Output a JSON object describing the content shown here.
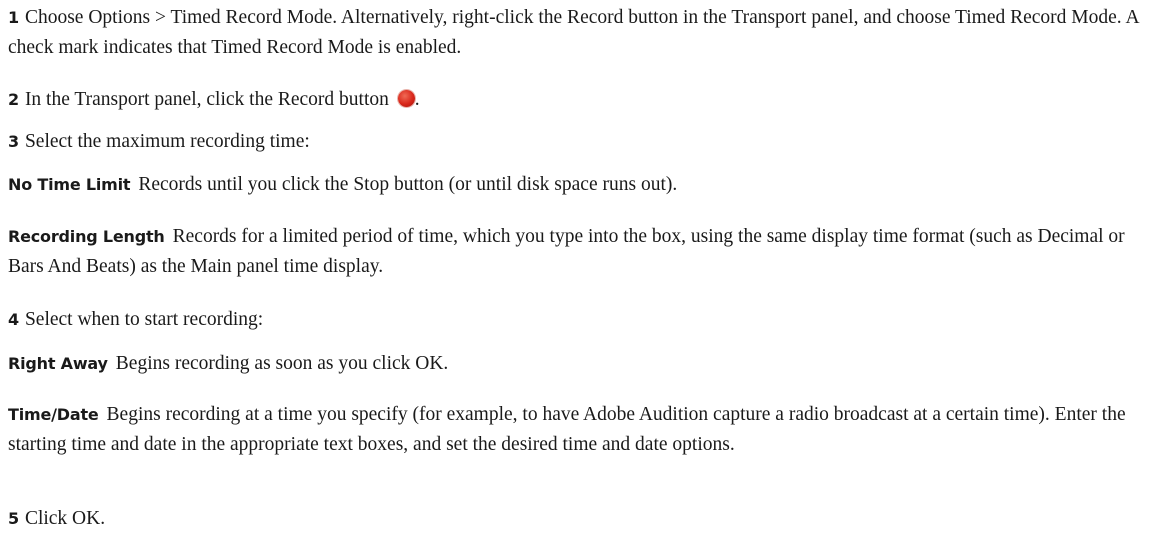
{
  "steps": [
    {
      "number": "1",
      "text": "Choose Options > Timed Record Mode. Alternatively, right-click the Record button in the Transport panel, and choose Timed Record Mode. A check mark indicates that Timed Record Mode is enabled."
    },
    {
      "number": "2",
      "text_before": "In the Transport panel, click the Record button",
      "icon": "record-button-icon",
      "icon_color": "#d8261a",
      "text_after": "."
    },
    {
      "number": "3",
      "text": "Select the maximum recording time:"
    },
    {
      "number": "4",
      "text": "Select when to start recording:"
    },
    {
      "number": "5",
      "text": "Click OK."
    }
  ],
  "options": [
    {
      "term": "No Time Limit",
      "text": "Records until you click the Stop button (or until disk space runs out)."
    },
    {
      "term": "Recording Length",
      "text": "Records for a limited period of time, which you type into the box, using the same display time format (such as Decimal or Bars And Beats) as the Main panel time display."
    },
    {
      "term": "Right Away",
      "text": "Begins recording as soon as you click OK."
    },
    {
      "term": "Time/Date",
      "text": "Begins recording at a time you specify (for example, to have Adobe Audition capture a radio broadcast at a certain time). Enter the starting time and date in the appropriate text boxes, and set the desired time and date options."
    }
  ]
}
